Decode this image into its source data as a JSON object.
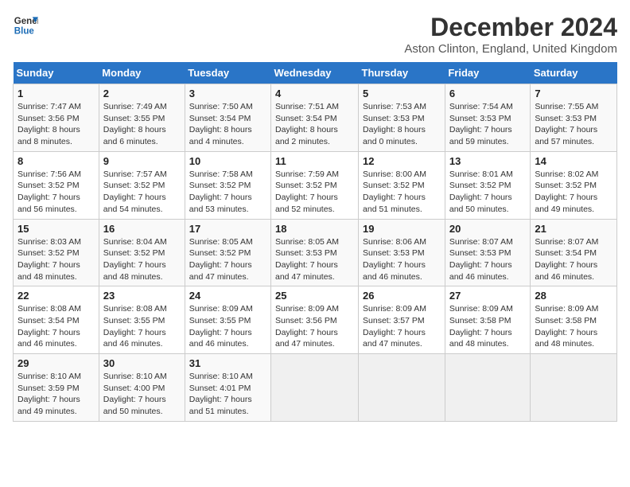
{
  "header": {
    "logo_line1": "General",
    "logo_line2": "Blue",
    "month_title": "December 2024",
    "location": "Aston Clinton, England, United Kingdom"
  },
  "weekdays": [
    "Sunday",
    "Monday",
    "Tuesday",
    "Wednesday",
    "Thursday",
    "Friday",
    "Saturday"
  ],
  "weeks": [
    [
      {
        "day": "1",
        "sunrise": "7:47 AM",
        "sunset": "3:56 PM",
        "daylight": "8 hours and 8 minutes."
      },
      {
        "day": "2",
        "sunrise": "7:49 AM",
        "sunset": "3:55 PM",
        "daylight": "8 hours and 6 minutes."
      },
      {
        "day": "3",
        "sunrise": "7:50 AM",
        "sunset": "3:54 PM",
        "daylight": "8 hours and 4 minutes."
      },
      {
        "day": "4",
        "sunrise": "7:51 AM",
        "sunset": "3:54 PM",
        "daylight": "8 hours and 2 minutes."
      },
      {
        "day": "5",
        "sunrise": "7:53 AM",
        "sunset": "3:53 PM",
        "daylight": "8 hours and 0 minutes."
      },
      {
        "day": "6",
        "sunrise": "7:54 AM",
        "sunset": "3:53 PM",
        "daylight": "7 hours and 59 minutes."
      },
      {
        "day": "7",
        "sunrise": "7:55 AM",
        "sunset": "3:53 PM",
        "daylight": "7 hours and 57 minutes."
      }
    ],
    [
      {
        "day": "8",
        "sunrise": "7:56 AM",
        "sunset": "3:52 PM",
        "daylight": "7 hours and 56 minutes."
      },
      {
        "day": "9",
        "sunrise": "7:57 AM",
        "sunset": "3:52 PM",
        "daylight": "7 hours and 54 minutes."
      },
      {
        "day": "10",
        "sunrise": "7:58 AM",
        "sunset": "3:52 PM",
        "daylight": "7 hours and 53 minutes."
      },
      {
        "day": "11",
        "sunrise": "7:59 AM",
        "sunset": "3:52 PM",
        "daylight": "7 hours and 52 minutes."
      },
      {
        "day": "12",
        "sunrise": "8:00 AM",
        "sunset": "3:52 PM",
        "daylight": "7 hours and 51 minutes."
      },
      {
        "day": "13",
        "sunrise": "8:01 AM",
        "sunset": "3:52 PM",
        "daylight": "7 hours and 50 minutes."
      },
      {
        "day": "14",
        "sunrise": "8:02 AM",
        "sunset": "3:52 PM",
        "daylight": "7 hours and 49 minutes."
      }
    ],
    [
      {
        "day": "15",
        "sunrise": "8:03 AM",
        "sunset": "3:52 PM",
        "daylight": "7 hours and 48 minutes."
      },
      {
        "day": "16",
        "sunrise": "8:04 AM",
        "sunset": "3:52 PM",
        "daylight": "7 hours and 48 minutes."
      },
      {
        "day": "17",
        "sunrise": "8:05 AM",
        "sunset": "3:52 PM",
        "daylight": "7 hours and 47 minutes."
      },
      {
        "day": "18",
        "sunrise": "8:05 AM",
        "sunset": "3:53 PM",
        "daylight": "7 hours and 47 minutes."
      },
      {
        "day": "19",
        "sunrise": "8:06 AM",
        "sunset": "3:53 PM",
        "daylight": "7 hours and 46 minutes."
      },
      {
        "day": "20",
        "sunrise": "8:07 AM",
        "sunset": "3:53 PM",
        "daylight": "7 hours and 46 minutes."
      },
      {
        "day": "21",
        "sunrise": "8:07 AM",
        "sunset": "3:54 PM",
        "daylight": "7 hours and 46 minutes."
      }
    ],
    [
      {
        "day": "22",
        "sunrise": "8:08 AM",
        "sunset": "3:54 PM",
        "daylight": "7 hours and 46 minutes."
      },
      {
        "day": "23",
        "sunrise": "8:08 AM",
        "sunset": "3:55 PM",
        "daylight": "7 hours and 46 minutes."
      },
      {
        "day": "24",
        "sunrise": "8:09 AM",
        "sunset": "3:55 PM",
        "daylight": "7 hours and 46 minutes."
      },
      {
        "day": "25",
        "sunrise": "8:09 AM",
        "sunset": "3:56 PM",
        "daylight": "7 hours and 47 minutes."
      },
      {
        "day": "26",
        "sunrise": "8:09 AM",
        "sunset": "3:57 PM",
        "daylight": "7 hours and 47 minutes."
      },
      {
        "day": "27",
        "sunrise": "8:09 AM",
        "sunset": "3:58 PM",
        "daylight": "7 hours and 48 minutes."
      },
      {
        "day": "28",
        "sunrise": "8:09 AM",
        "sunset": "3:58 PM",
        "daylight": "7 hours and 48 minutes."
      }
    ],
    [
      {
        "day": "29",
        "sunrise": "8:10 AM",
        "sunset": "3:59 PM",
        "daylight": "7 hours and 49 minutes."
      },
      {
        "day": "30",
        "sunrise": "8:10 AM",
        "sunset": "4:00 PM",
        "daylight": "7 hours and 50 minutes."
      },
      {
        "day": "31",
        "sunrise": "8:10 AM",
        "sunset": "4:01 PM",
        "daylight": "7 hours and 51 minutes."
      },
      null,
      null,
      null,
      null
    ]
  ]
}
